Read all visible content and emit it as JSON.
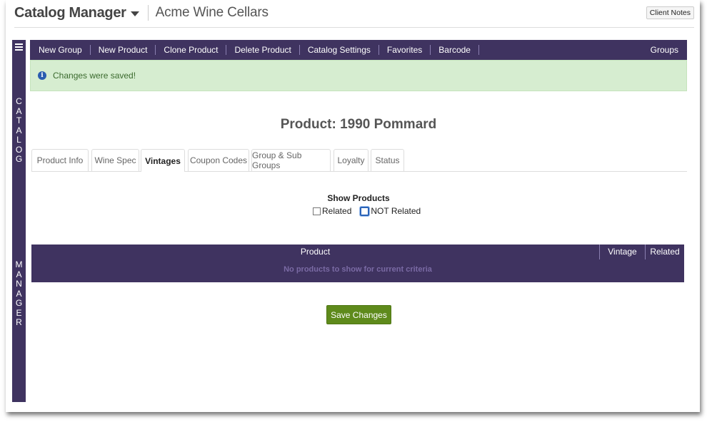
{
  "header": {
    "app_title": "Catalog Manager",
    "client_name": "Acme Wine Cellars",
    "client_notes_label": "Client Notes"
  },
  "sidebar": {
    "top_letters": [
      "C",
      "A",
      "T",
      "A",
      "L",
      "O",
      "G"
    ],
    "bottom_letters": [
      "M",
      "A",
      "N",
      "A",
      "G",
      "E",
      "R"
    ]
  },
  "toolbar": {
    "items": [
      "New Group",
      "New Product",
      "Clone Product",
      "Delete Product",
      "Catalog Settings",
      "Favorites",
      "Barcode"
    ],
    "right_item": "Groups"
  },
  "alert": {
    "icon": "info-icon",
    "message": "Changes were saved!"
  },
  "page": {
    "title": "Product: 1990 Pommard"
  },
  "tabs": {
    "items": [
      "Product Info",
      "Wine Spec",
      "Vintages",
      "Coupon Codes",
      "Group & Sub Groups",
      "Loyalty",
      "Status"
    ],
    "active": "Vintages"
  },
  "filter": {
    "title": "Show Products",
    "options": [
      {
        "label": "Related",
        "checked": false
      },
      {
        "label": "NOT Related",
        "checked": false,
        "focused": true
      }
    ]
  },
  "table": {
    "columns": [
      "Product",
      "Vintage",
      "Related"
    ],
    "empty_message": "No products to show for current criteria"
  },
  "actions": {
    "save_label": "Save Changes"
  },
  "colors": {
    "primary_purple": "#3f3360",
    "success_bg": "#d6edd0",
    "save_green": "#5e8a1b"
  }
}
